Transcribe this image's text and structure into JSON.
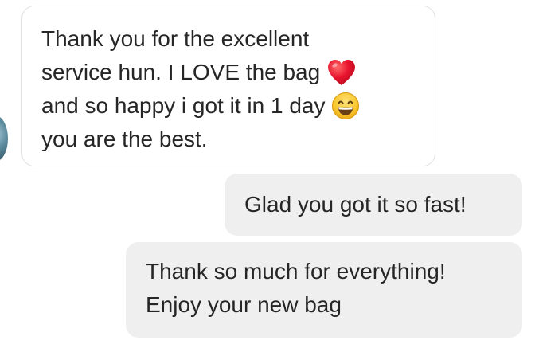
{
  "conversation": {
    "messages": [
      {
        "direction": "incoming",
        "lines": [
          "Thank you for the excellent",
          "service hun. I LOVE the bag",
          "and so happy i got it in 1 day",
          "you are the best."
        ],
        "inline_icons": [
          "red-heart-icon",
          "grinning-face-icon"
        ]
      },
      {
        "direction": "outgoing",
        "text": "Glad you got it so fast!"
      },
      {
        "direction": "outgoing",
        "lines": [
          "Thank so much for everything!",
          "Enjoy your new bag"
        ]
      }
    ]
  },
  "colors": {
    "incoming_bubble_bg": "#ffffff",
    "incoming_bubble_border": "#e3e3e3",
    "outgoing_bubble_bg": "#efefef",
    "text": "#262626",
    "heart": "#e0102a",
    "emoji_face": "#f7c52b"
  }
}
